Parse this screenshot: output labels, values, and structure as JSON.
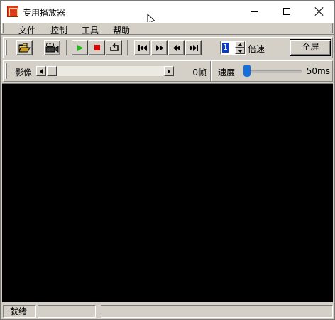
{
  "window": {
    "title": "专用播放器",
    "icon": "app-film-icon"
  },
  "menu": {
    "items": [
      {
        "label": "文件"
      },
      {
        "label": "控制"
      },
      {
        "label": "工具"
      },
      {
        "label": "帮助"
      }
    ]
  },
  "toolbar": {
    "buttons": [
      {
        "name": "open-folder-icon"
      },
      {
        "name": "camera-icon"
      },
      {
        "name": "play-icon",
        "color": "#17c017"
      },
      {
        "name": "stop-icon",
        "color": "#e00000"
      },
      {
        "name": "loop-icon"
      },
      {
        "name": "skip-to-start-icon"
      },
      {
        "name": "fast-forward-icon"
      },
      {
        "name": "rewind-icon"
      },
      {
        "name": "skip-to-end-icon"
      }
    ],
    "speed_value": "1",
    "speed_label": "倍速",
    "fullscreen_label": "全屏"
  },
  "timeline": {
    "label": "影像",
    "frame_text": "0帧",
    "speed_label": "速度",
    "speed_ms_text": "50ms",
    "speed_level": 0.0
  },
  "status": {
    "text": "就绪"
  },
  "colors": {
    "face": "#d4d0c8",
    "video_bg": "#000000",
    "slider_accent": "#1470d8"
  }
}
